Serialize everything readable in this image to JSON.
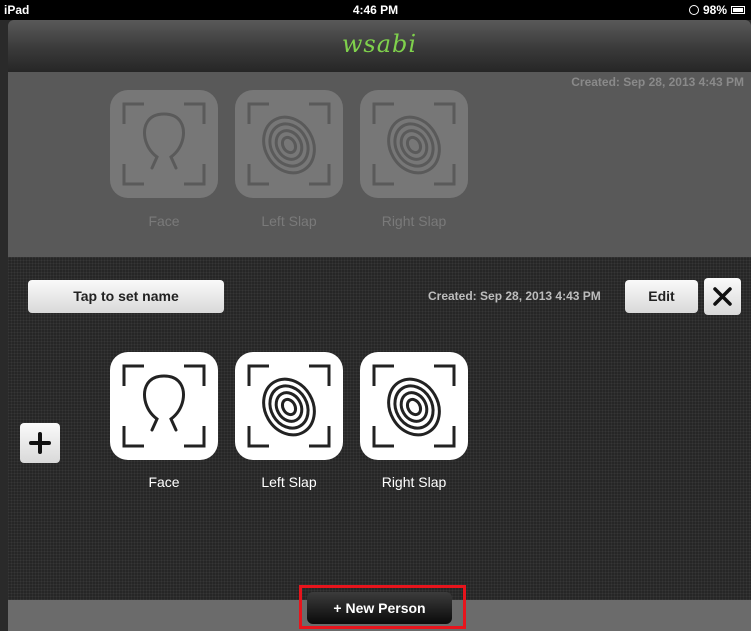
{
  "status_bar": {
    "carrier": "iPad",
    "time": "4:46 PM",
    "battery": "98%"
  },
  "app": {
    "title": "wsabi"
  },
  "records": [
    {
      "created": "Created: Sep 28, 2013 4:43 PM",
      "modalities": [
        {
          "label": "Face",
          "icon": "face-icon"
        },
        {
          "label": "Left Slap",
          "icon": "fingerprint-icon"
        },
        {
          "label": "Right Slap",
          "icon": "fingerprint-icon"
        }
      ]
    },
    {
      "name_button": "Tap to set name",
      "created": "Created: Sep 28, 2013 4:43 PM",
      "edit_label": "Edit",
      "modalities": [
        {
          "label": "Face",
          "icon": "face-icon"
        },
        {
          "label": "Left Slap",
          "icon": "fingerprint-icon"
        },
        {
          "label": "Right Slap",
          "icon": "fingerprint-icon"
        }
      ]
    }
  ],
  "toolbar": {
    "new_person_label": "+ New Person"
  },
  "colors": {
    "title_green": "#7fd14c",
    "highlight_red": "#e8141c"
  }
}
